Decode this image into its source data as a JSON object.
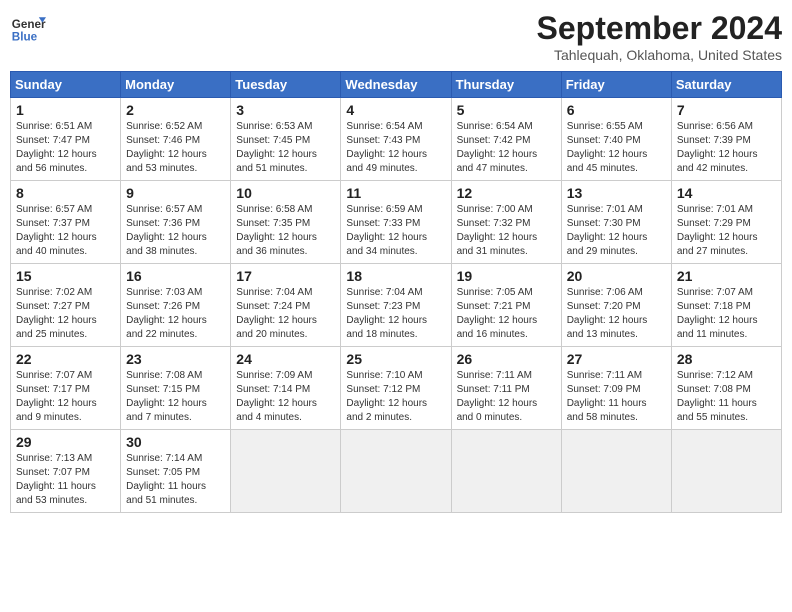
{
  "header": {
    "logo_line1": "General",
    "logo_line2": "Blue",
    "month": "September 2024",
    "location": "Tahlequah, Oklahoma, United States"
  },
  "weekdays": [
    "Sunday",
    "Monday",
    "Tuesday",
    "Wednesday",
    "Thursday",
    "Friday",
    "Saturday"
  ],
  "weeks": [
    [
      {
        "day": "1",
        "rise": "6:51 AM",
        "set": "7:47 PM",
        "daylight": "12 hours and 56 minutes."
      },
      {
        "day": "2",
        "rise": "6:52 AM",
        "set": "7:46 PM",
        "daylight": "12 hours and 53 minutes."
      },
      {
        "day": "3",
        "rise": "6:53 AM",
        "set": "7:45 PM",
        "daylight": "12 hours and 51 minutes."
      },
      {
        "day": "4",
        "rise": "6:54 AM",
        "set": "7:43 PM",
        "daylight": "12 hours and 49 minutes."
      },
      {
        "day": "5",
        "rise": "6:54 AM",
        "set": "7:42 PM",
        "daylight": "12 hours and 47 minutes."
      },
      {
        "day": "6",
        "rise": "6:55 AM",
        "set": "7:40 PM",
        "daylight": "12 hours and 45 minutes."
      },
      {
        "day": "7",
        "rise": "6:56 AM",
        "set": "7:39 PM",
        "daylight": "12 hours and 42 minutes."
      }
    ],
    [
      {
        "day": "8",
        "rise": "6:57 AM",
        "set": "7:37 PM",
        "daylight": "12 hours and 40 minutes."
      },
      {
        "day": "9",
        "rise": "6:57 AM",
        "set": "7:36 PM",
        "daylight": "12 hours and 38 minutes."
      },
      {
        "day": "10",
        "rise": "6:58 AM",
        "set": "7:35 PM",
        "daylight": "12 hours and 36 minutes."
      },
      {
        "day": "11",
        "rise": "6:59 AM",
        "set": "7:33 PM",
        "daylight": "12 hours and 34 minutes."
      },
      {
        "day": "12",
        "rise": "7:00 AM",
        "set": "7:32 PM",
        "daylight": "12 hours and 31 minutes."
      },
      {
        "day": "13",
        "rise": "7:01 AM",
        "set": "7:30 PM",
        "daylight": "12 hours and 29 minutes."
      },
      {
        "day": "14",
        "rise": "7:01 AM",
        "set": "7:29 PM",
        "daylight": "12 hours and 27 minutes."
      }
    ],
    [
      {
        "day": "15",
        "rise": "7:02 AM",
        "set": "7:27 PM",
        "daylight": "12 hours and 25 minutes."
      },
      {
        "day": "16",
        "rise": "7:03 AM",
        "set": "7:26 PM",
        "daylight": "12 hours and 22 minutes."
      },
      {
        "day": "17",
        "rise": "7:04 AM",
        "set": "7:24 PM",
        "daylight": "12 hours and 20 minutes."
      },
      {
        "day": "18",
        "rise": "7:04 AM",
        "set": "7:23 PM",
        "daylight": "12 hours and 18 minutes."
      },
      {
        "day": "19",
        "rise": "7:05 AM",
        "set": "7:21 PM",
        "daylight": "12 hours and 16 minutes."
      },
      {
        "day": "20",
        "rise": "7:06 AM",
        "set": "7:20 PM",
        "daylight": "12 hours and 13 minutes."
      },
      {
        "day": "21",
        "rise": "7:07 AM",
        "set": "7:18 PM",
        "daylight": "12 hours and 11 minutes."
      }
    ],
    [
      {
        "day": "22",
        "rise": "7:07 AM",
        "set": "7:17 PM",
        "daylight": "12 hours and 9 minutes."
      },
      {
        "day": "23",
        "rise": "7:08 AM",
        "set": "7:15 PM",
        "daylight": "12 hours and 7 minutes."
      },
      {
        "day": "24",
        "rise": "7:09 AM",
        "set": "7:14 PM",
        "daylight": "12 hours and 4 minutes."
      },
      {
        "day": "25",
        "rise": "7:10 AM",
        "set": "7:12 PM",
        "daylight": "12 hours and 2 minutes."
      },
      {
        "day": "26",
        "rise": "7:11 AM",
        "set": "7:11 PM",
        "daylight": "12 hours and 0 minutes."
      },
      {
        "day": "27",
        "rise": "7:11 AM",
        "set": "7:09 PM",
        "daylight": "11 hours and 58 minutes."
      },
      {
        "day": "28",
        "rise": "7:12 AM",
        "set": "7:08 PM",
        "daylight": "11 hours and 55 minutes."
      }
    ],
    [
      {
        "day": "29",
        "rise": "7:13 AM",
        "set": "7:07 PM",
        "daylight": "11 hours and 53 minutes."
      },
      {
        "day": "30",
        "rise": "7:14 AM",
        "set": "7:05 PM",
        "daylight": "11 hours and 51 minutes."
      },
      null,
      null,
      null,
      null,
      null
    ]
  ]
}
